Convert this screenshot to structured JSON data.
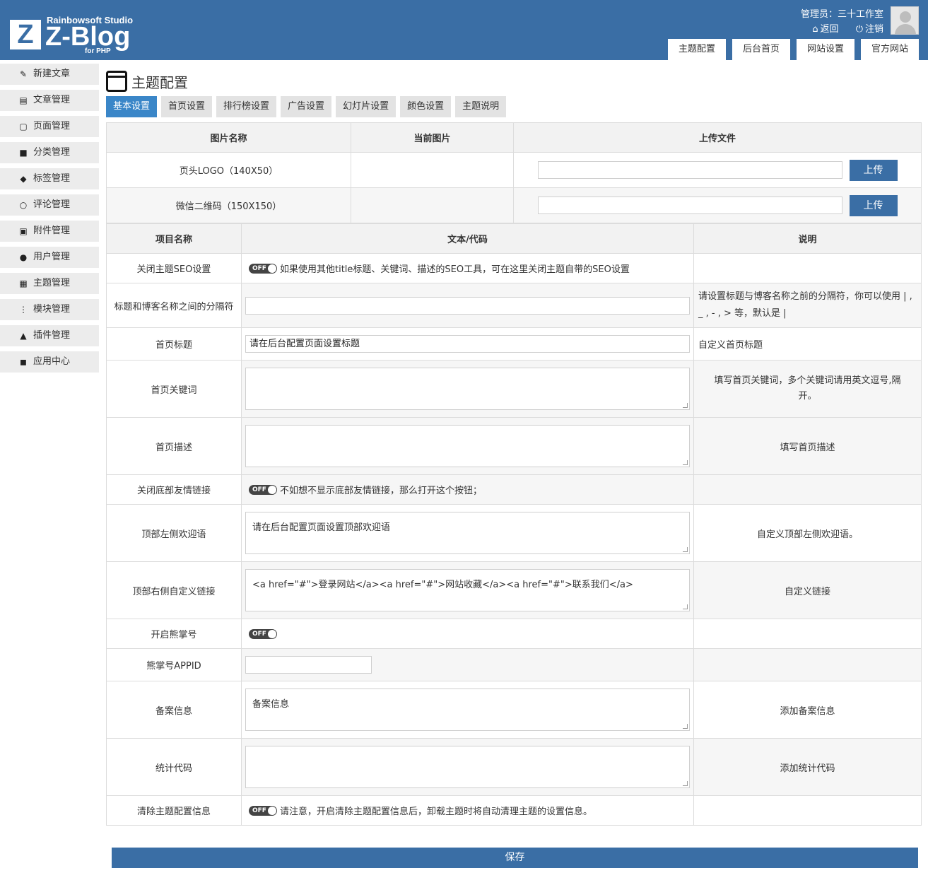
{
  "header": {
    "logo_box": "Z",
    "logo_studio": "Rainbowsoft Studio",
    "logo_main": "Z-Blog",
    "logo_sub": "for PHP",
    "admin_label": "管理员：三十工作室",
    "back_label": "返回",
    "logout_label": "注销",
    "tabs": [
      "主题配置",
      "后台首页",
      "网站设置",
      "官方网站"
    ]
  },
  "sidebar": {
    "items": [
      {
        "label": "新建文章",
        "icon": "edit-icon"
      },
      {
        "label": "文章管理",
        "icon": "document-icon"
      },
      {
        "label": "页面管理",
        "icon": "page-icon"
      },
      {
        "label": "分类管理",
        "icon": "folder-icon"
      },
      {
        "label": "标签管理",
        "icon": "tag-icon"
      },
      {
        "label": "评论管理",
        "icon": "comment-icon"
      },
      {
        "label": "附件管理",
        "icon": "attachment-icon"
      },
      {
        "label": "用户管理",
        "icon": "user-icon"
      },
      {
        "label": "主题管理",
        "icon": "theme-icon"
      },
      {
        "label": "模块管理",
        "icon": "module-icon"
      },
      {
        "label": "插件管理",
        "icon": "plugin-icon"
      },
      {
        "label": "应用中心",
        "icon": "app-center-icon"
      }
    ]
  },
  "main": {
    "title": "主题配置",
    "tabs": [
      "基本设置",
      "首页设置",
      "排行榜设置",
      "广告设置",
      "幻灯片设置",
      "颜色设置",
      "主题说明"
    ],
    "active_tab": 0
  },
  "image_table": {
    "headers": [
      "图片名称",
      "当前图片",
      "上传文件"
    ],
    "rows": [
      {
        "name": "页头LOGO（140X50）",
        "button": "上传"
      },
      {
        "name": "微信二维码（150X150）",
        "button": "上传"
      }
    ]
  },
  "config_table": {
    "headers": [
      "项目名称",
      "文本/代码",
      "说明"
    ],
    "rows": [
      {
        "name": "关闭主题SEO设置",
        "toggle": "OFF",
        "code": "如果使用其他title标题、关键词、描述的SEO工具，可在这里关闭主题自带的SEO设置",
        "desc": ""
      },
      {
        "name": "标题和博客名称之间的分隔符",
        "input": "",
        "desc": "请设置标题与博客名称之前的分隔符，你可以使用 | , _ , - , > 等，默认是 |"
      },
      {
        "name": "首页标题",
        "input": "请在后台配置页面设置标题",
        "desc": "自定义首页标题"
      },
      {
        "name": "首页关键词",
        "textarea": "",
        "desc": "填写首页关键词，多个关键词请用英文逗号,隔开。"
      },
      {
        "name": "首页描述",
        "textarea": "",
        "desc": "填写首页描述"
      },
      {
        "name": "关闭底部友情链接",
        "toggle": "OFF",
        "code": "不如想不显示底部友情链接，那么打开这个按钮；",
        "desc": ""
      },
      {
        "name": "顶部左侧欢迎语",
        "textarea": "请在后台配置页面设置顶部欢迎语",
        "desc": "自定义顶部左侧欢迎语。"
      },
      {
        "name": "顶部右侧自定义链接",
        "textarea": "<a href=\"#\">登录网站</a><a href=\"#\">网站收藏</a><a href=\"#\">联系我们</a>",
        "desc": "自定义链接"
      },
      {
        "name": "开启熊掌号",
        "toggle": "OFF",
        "code": "",
        "desc": ""
      },
      {
        "name": "熊掌号APPID",
        "input": "",
        "desc": ""
      },
      {
        "name": "备案信息",
        "textarea": "备案信息",
        "desc": "添加备案信息"
      },
      {
        "name": "统计代码",
        "textarea": "",
        "desc": "添加统计代码"
      },
      {
        "name": "清除主题配置信息",
        "toggle": "OFF",
        "code": "请注意，开启清除主题配置信息后，卸载主题时将自动清理主题的设置信息。",
        "desc": ""
      }
    ]
  },
  "save_label": "保存",
  "colors": {
    "brand": "#3a6ea5",
    "active_tab": "#3a86c8"
  }
}
